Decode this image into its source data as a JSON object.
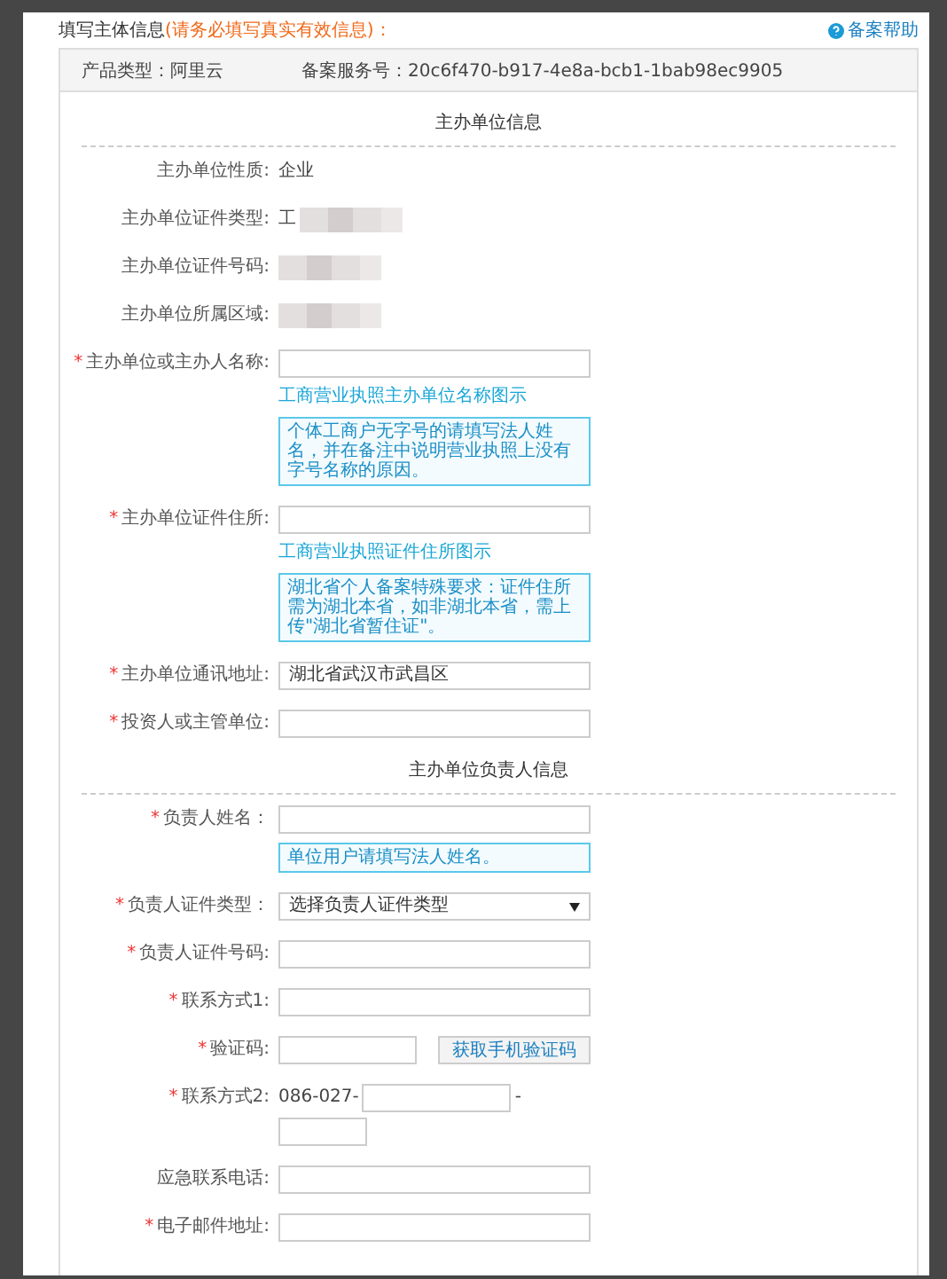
{
  "header": {
    "title": "填写主体信息",
    "note": "(请务必填写真实有效信息)：",
    "help": "备案帮助"
  },
  "info_bar": [
    {
      "label": "产品类型：",
      "value": "阿里云"
    },
    {
      "label": "备案服务号：",
      "value": "20c6f470-b917-4e8a-bcb1-1bab98ec9905"
    }
  ],
  "sections": [
    {
      "title": "主办单位信息",
      "rows": [
        {
          "kind": "text",
          "label": "主办单位性质:",
          "value": "企业",
          "redacted": false
        },
        {
          "kind": "text",
          "label": "主办单位证件类型:",
          "value": "工",
          "redacted": true
        },
        {
          "kind": "text",
          "label": "主办单位证件号码:",
          "redacted": true
        },
        {
          "kind": "text",
          "label": "主办单位所属区域:",
          "redacted": true
        },
        {
          "kind": "input",
          "mark": "*",
          "label": "主办单位或主办人名称:",
          "link": "工商营业执照主办单位名称图示",
          "note": "个体工商户无字号的请填写法人姓名，并在备注中说明营业执照上没有字号名称的原因。"
        },
        {
          "kind": "input",
          "mark": "*",
          "label": "主办单位证件住所:",
          "link": "工商营业执照证件住所图示",
          "note": "湖北省个人备案特殊要求：证件住所需为湖北本省，如非湖北本省，需上传\"湖北省暂住证\"。"
        },
        {
          "kind": "input",
          "mark": "*",
          "label": "主办单位通讯地址:",
          "value": "湖北省武汉市武昌区"
        },
        {
          "kind": "input",
          "mark": "*",
          "label": "投资人或主管单位:"
        }
      ]
    },
    {
      "title": "主办单位负责人信息",
      "rows": [
        {
          "kind": "input",
          "mark": "*",
          "label": "负责人姓名：",
          "note": "单位用户请填写法人姓名。"
        },
        {
          "kind": "select",
          "mark": "*",
          "label": "负责人证件类型：",
          "value": "选择负责人证件类型"
        },
        {
          "kind": "input",
          "mark": "*",
          "label": "负责人证件号码:"
        },
        {
          "kind": "input",
          "mark": "*",
          "label": "联系方式1:"
        },
        {
          "kind": "code",
          "mark": "*",
          "label": "验证码:",
          "button": "获取手机验证码"
        },
        {
          "kind": "phone",
          "mark": "*",
          "label": "联系方式2:",
          "prefix": "086-027-",
          "separator": "-"
        },
        {
          "kind": "input",
          "label": "应急联系电话:"
        },
        {
          "kind": "input",
          "mark": "*",
          "label": "电子邮件地址:"
        }
      ]
    }
  ]
}
